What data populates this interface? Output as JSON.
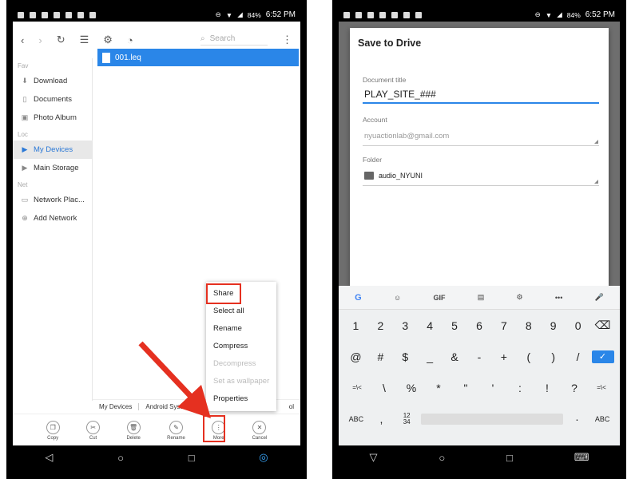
{
  "status": {
    "battery": "84%",
    "time": "6:52 PM"
  },
  "left": {
    "toolbar": {
      "search_placeholder": "Search"
    },
    "sidebar": {
      "sections": [
        {
          "label": "Fav",
          "items": [
            "Download",
            "Documents",
            "Photo Album"
          ]
        },
        {
          "label": "Loc",
          "items": [
            "My Devices",
            "Main Storage"
          ]
        },
        {
          "label": "Net",
          "items": [
            "Network Plac...",
            "Add Network"
          ]
        }
      ],
      "active": "My Devices"
    },
    "file": "001.leq",
    "breadcrumbs": [
      "My Devices",
      "Android Syst...",
      "ol"
    ],
    "menu": [
      "Share",
      "Select all",
      "Rename",
      "Compress",
      "Decompress",
      "Set as wallpaper",
      "Properties"
    ],
    "menu_disabled": [
      "Decompress",
      "Set as wallpaper"
    ],
    "bottom": [
      "Copy",
      "Cut",
      "Delete",
      "Rename",
      "More",
      "Cancel"
    ],
    "highlight_color": "#e53020",
    "accent": "#2a86e8"
  },
  "right": {
    "dialog": {
      "title": "Save to Drive",
      "doc_label": "Document title",
      "doc_value": "PLAY_SITE_###",
      "account_label": "Account",
      "account_value": "nyuactionlab@gmail.com",
      "folder_label": "Folder",
      "folder_value": "audio_NYUNI"
    },
    "keyboard": {
      "top": [
        "G",
        "☺",
        "GIF",
        "▤",
        "⚙",
        "•••",
        "🎤"
      ],
      "row1": [
        "1",
        "2",
        "3",
        "4",
        "5",
        "6",
        "7",
        "8",
        "9",
        "0",
        "⌫"
      ],
      "row2": [
        "@",
        "#",
        "$",
        "_",
        "&",
        "-",
        "+",
        "(",
        ")",
        "/",
        "✓"
      ],
      "row3": [
        "=\\<",
        "\\",
        "%",
        "*",
        "\"",
        "'",
        ":",
        "!",
        "?",
        "=\\<"
      ],
      "row4_left": "ABC",
      "row4_mid": ",",
      "row4_fr": "12\n34",
      "row4_dot": "·",
      "row4_right": "ABC"
    }
  }
}
